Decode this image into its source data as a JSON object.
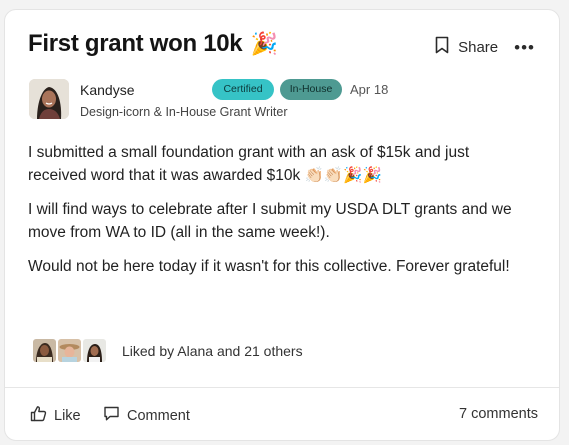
{
  "post": {
    "title": "First grant won 10k",
    "title_emoji": "🎉",
    "share_label": "Share",
    "more_label": "•••",
    "author": {
      "name": "Kandyse",
      "role": "Design-icorn & In-House Grant Writer",
      "badges": [
        "Certified",
        "In-House"
      ],
      "date": "Apr 18"
    },
    "paragraphs": [
      "I submitted a small foundation grant with an ask of $15k and just received word that it was awarded $10k 👏🏻👏🏻🎉🎉",
      "I will find ways to celebrate after I submit my USDA DLT grants and we move from WA to ID (all in the same week!).",
      "Would not be here today if it wasn't for this collective. Forever grateful!"
    ],
    "likes_text": "Liked by Alana and 21 others",
    "footer": {
      "like_label": "Like",
      "comment_label": "Comment",
      "comments_count": "7 comments"
    }
  },
  "colors": {
    "badge_certified": "#36c3c6",
    "badge_inhouse": "#4e9a92",
    "divider": "#e6e6e6"
  },
  "icons": [
    "bookmark-icon",
    "more-icon",
    "thumbs-up-icon",
    "comment-icon"
  ]
}
